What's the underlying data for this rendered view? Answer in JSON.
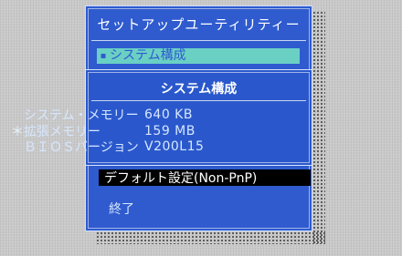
{
  "dialog": {
    "title": "セットアップユーティリティー"
  },
  "main_menu": {
    "selected_marker": "▪",
    "selected_item": "システム構成"
  },
  "submenu": {
    "title": "システム構成",
    "rows": [
      {
        "marker": "",
        "label": "システム・メモリー",
        "value": "640 KB"
      },
      {
        "marker": "＊",
        "label": "拡張メモリー",
        "value": "159 MB"
      },
      {
        "marker": "",
        "label": "ＢＩＯＳバージョン",
        "value": "V200L15"
      }
    ]
  },
  "lower_menu": {
    "default_setting": "デフォルト設定(Non-PnP)",
    "exit": "終了"
  },
  "colors": {
    "background": "#c9c9c9",
    "window": "#2f5bcf",
    "highlight": "#6ad0c4",
    "selected_bar": "#000000",
    "text": "#ffffff"
  }
}
